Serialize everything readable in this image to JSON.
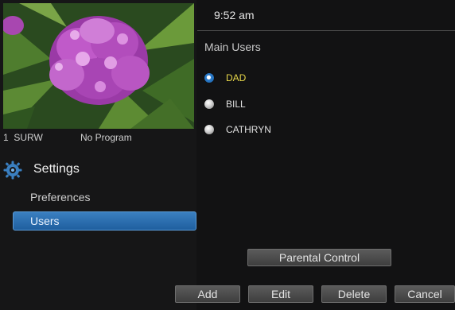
{
  "preview": {
    "channel_number": "1",
    "channel_name": "SURW",
    "program": "No Program"
  },
  "settings": {
    "title": "Settings",
    "icon": "gear-icon",
    "menu": [
      {
        "label": "Preferences",
        "active": false
      },
      {
        "label": "Users",
        "active": true
      }
    ]
  },
  "header": {
    "clock": "9:52 am"
  },
  "users": {
    "section_title": "Main Users",
    "list": [
      {
        "name": "DAD",
        "selected": true
      },
      {
        "name": "BILL",
        "selected": false
      },
      {
        "name": "CATHRYN",
        "selected": false
      }
    ]
  },
  "buttons": {
    "parental_control": "Parental Control",
    "add": "Add",
    "edit": "Edit",
    "delete": "Delete",
    "cancel": "Cancel"
  },
  "colors": {
    "accent_blue": "#2a6fb0",
    "selected_text": "#e8d84a",
    "background": "#121213"
  }
}
